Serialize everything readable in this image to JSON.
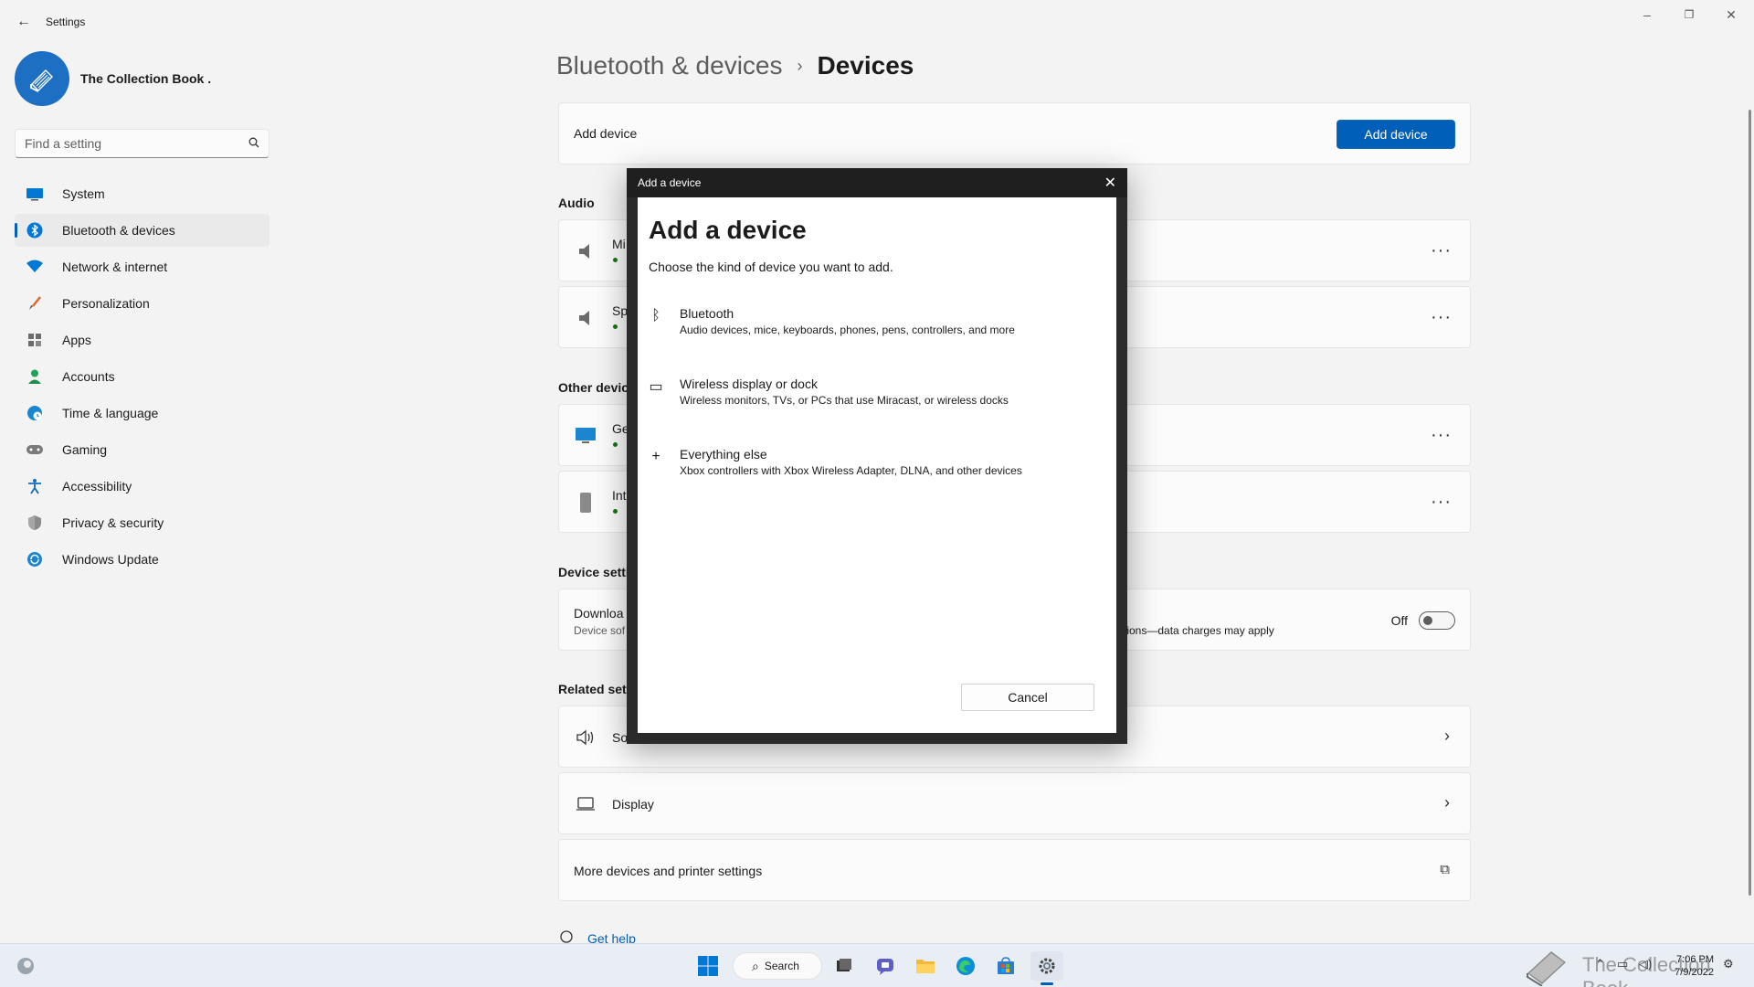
{
  "window": {
    "title": "Settings",
    "back_glyph": "←",
    "minimize_glyph": "–",
    "maximize_glyph": "❐",
    "close_glyph": "✕"
  },
  "profile": {
    "name": "The Collection Book ."
  },
  "search": {
    "placeholder": "Find a setting"
  },
  "sidebar": {
    "items": [
      {
        "label": "System",
        "icon": "system-icon",
        "active": false
      },
      {
        "label": "Bluetooth & devices",
        "icon": "bluetooth-icon",
        "active": true
      },
      {
        "label": "Network & internet",
        "icon": "wifi-icon",
        "active": false
      },
      {
        "label": "Personalization",
        "icon": "brush-icon",
        "active": false
      },
      {
        "label": "Apps",
        "icon": "apps-icon",
        "active": false
      },
      {
        "label": "Accounts",
        "icon": "accounts-icon",
        "active": false
      },
      {
        "label": "Time & language",
        "icon": "globe-clock-icon",
        "active": false
      },
      {
        "label": "Gaming",
        "icon": "gamepad-icon",
        "active": false
      },
      {
        "label": "Accessibility",
        "icon": "accessibility-icon",
        "active": false
      },
      {
        "label": "Privacy & security",
        "icon": "shield-icon",
        "active": false
      },
      {
        "label": "Windows Update",
        "icon": "update-icon",
        "active": false
      }
    ]
  },
  "breadcrumb": {
    "parent": "Bluetooth & devices",
    "separator": "›",
    "current": "Devices"
  },
  "main": {
    "add_device_label": "Add device",
    "add_device_button": "Add device",
    "audio_title": "Audio",
    "audio_devices": [
      {
        "name": "Mi"
      },
      {
        "name": "Sp"
      }
    ],
    "more_glyph": "···",
    "other_title": "Other devic",
    "other_devices": [
      {
        "name": "Ge"
      },
      {
        "name": "Int"
      }
    ],
    "device_settings_title": "Device setti",
    "download_title": "Downloa",
    "download_sub": "Device sof",
    "download_sub_tail": "ctions—data charges may apply",
    "download_toggle_state": "Off",
    "related_title": "Related sett",
    "related": [
      {
        "label": "So",
        "icon": "speaker-icon"
      },
      {
        "label": "Display",
        "icon": "laptop-icon"
      }
    ],
    "chevron_glyph": "›",
    "more_devices_label": "More devices and printer settings",
    "external_glyph": "⧉",
    "get_help": "Get help"
  },
  "dialog": {
    "window_title": "Add a device",
    "close_glyph": "✕",
    "heading": "Add a device",
    "description": "Choose the kind of device you want to add.",
    "options": [
      {
        "title": "Bluetooth",
        "desc": "Audio devices, mice, keyboards, phones, pens, controllers, and more",
        "icon": "bluetooth-icon"
      },
      {
        "title": "Wireless display or dock",
        "desc": "Wireless monitors, TVs, or PCs that use Miracast, or wireless docks",
        "icon": "monitor-icon"
      },
      {
        "title": "Everything else",
        "desc": "Xbox controllers with Xbox Wireless Adapter, DLNA, and other devices",
        "icon": "plus-icon"
      }
    ],
    "option_glyphs": [
      "ᛒ",
      "▭",
      "+"
    ],
    "cancel": "Cancel"
  },
  "taskbar": {
    "search_label": "Search",
    "search_glyph": "⌕",
    "time": "7:06 PM",
    "date": "7/9/2022",
    "watermark": "The Collection Book"
  },
  "colors": {
    "accent": "#005fb8",
    "status_green": "#0f7b0f",
    "dialog_titlebar": "#1f1f1f"
  }
}
